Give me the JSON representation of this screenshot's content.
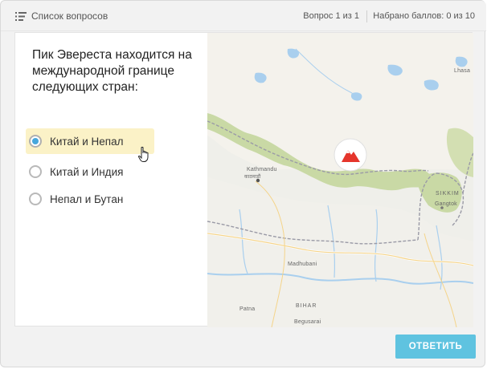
{
  "header": {
    "question_list_label": "Список вопросов",
    "question_counter": "Вопрос 1 из 1",
    "score_label": "Набрано баллов: 0 из 10"
  },
  "question": {
    "text": "Пик Эвереста находится на международной границе следующих стран:"
  },
  "options": [
    {
      "label": "Китай и Непал",
      "selected": true
    },
    {
      "label": "Китай и Индия",
      "selected": false
    },
    {
      "label": "Непал и Бутан",
      "selected": false
    }
  ],
  "map": {
    "labels": {
      "kathmandu": "Kathmandu",
      "kathmandu_native": "काठमाडौं",
      "sikkim": "SIKKIM",
      "gangtok": "Gangtok",
      "madhubani": "Madhubani",
      "bihar": "BIHAR",
      "begusarai": "Begusarai",
      "patna": "Patna",
      "lhasa": "Lhasa"
    },
    "marker_icon": "mountain-icon",
    "marker_color": "#e5352b"
  },
  "footer": {
    "submit_label": "ОТВЕТИТЬ"
  },
  "colors": {
    "accent": "#5fc3e0",
    "radio_checked": "#47a7dc",
    "selected_bg": "#fbf2c7"
  }
}
